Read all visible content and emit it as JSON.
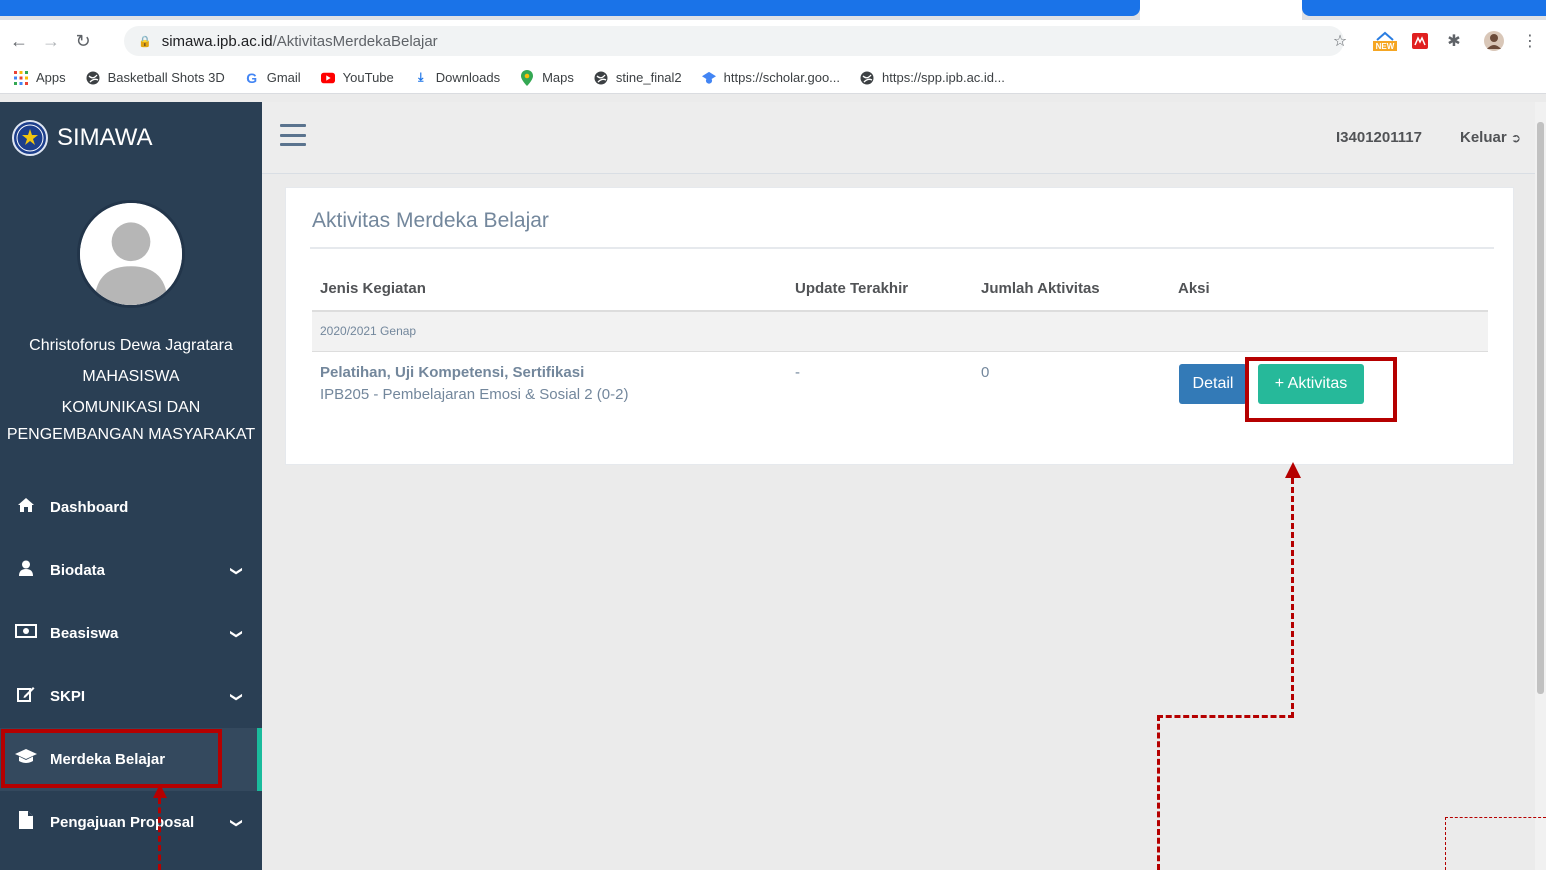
{
  "browser": {
    "url_host": "simawa.ipb.ac.id",
    "url_path": "/AktivitasMerdekaBelajar",
    "bookmarks": [
      {
        "label": "Apps",
        "icon": "apps-grid-icon"
      },
      {
        "label": "Basketball Shots 3D",
        "icon": "globe-icon"
      },
      {
        "label": "Gmail",
        "icon": "google-g-icon"
      },
      {
        "label": "YouTube",
        "icon": "youtube-icon"
      },
      {
        "label": "Downloads",
        "icon": "download-icon"
      },
      {
        "label": "Maps",
        "icon": "map-pin-icon"
      },
      {
        "label": "stine_final2",
        "icon": "globe-icon"
      },
      {
        "label": "https://scholar.goo...",
        "icon": "scholar-icon"
      },
      {
        "label": "https://spp.ipb.ac.id...",
        "icon": "globe-icon"
      }
    ],
    "ext_new_badge": "NEW"
  },
  "sidebar": {
    "brand": "SIMAWA",
    "profile": {
      "name": "Christoforus Dewa Jagratara",
      "role": "MAHASISWA",
      "dept_line1": "KOMUNIKASI DAN",
      "dept_line2": "PENGEMBANGAN MASYARAKAT"
    },
    "menu": [
      {
        "label": "Dashboard",
        "icon": "home-icon",
        "chevron": false
      },
      {
        "label": "Biodata",
        "icon": "user-icon",
        "chevron": true
      },
      {
        "label": "Beasiswa",
        "icon": "money-icon",
        "chevron": true
      },
      {
        "label": "SKPI",
        "icon": "edit-icon",
        "chevron": true
      },
      {
        "label": "Merdeka Belajar",
        "icon": "graduation-cap-icon",
        "chevron": false
      },
      {
        "label": "Pengajuan Proposal",
        "icon": "file-icon",
        "chevron": true
      }
    ]
  },
  "topnav": {
    "user_id": "I3401201117",
    "logout": "Keluar"
  },
  "panel": {
    "title": "Aktivitas Merdeka Belajar",
    "columns": [
      "Jenis Kegiatan",
      "Update Terakhir",
      "Jumlah Aktivitas",
      "Aksi"
    ],
    "group": "2020/2021 Genap",
    "row": {
      "kegiatan": "Pelatihan, Uji Kompetensi, Sertifikasi",
      "mata_kuliah": "IPB205 - Pembelajaran Emosi & Sosial 2 (0-2)",
      "update": "-",
      "jumlah": "0",
      "detail_btn": "Detail",
      "add_btn": "+ Aktivitas"
    }
  },
  "colors": {
    "sidebar": "#2a3f54",
    "accent_green": "#26b99a",
    "detail_blue": "#337ab7",
    "annotation_red": "#b50000"
  }
}
